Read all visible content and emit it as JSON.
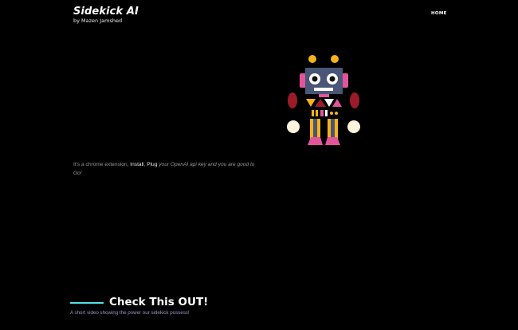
{
  "header": {
    "title": "Sidekick AI",
    "subtitle": "by Mazen Jamshed",
    "nav": {
      "home_label": "HOME"
    }
  },
  "hero": {
    "intro_text": "It's a chrome extension,",
    "step_install": "Install",
    "step_plug": "Plug",
    "intro_rest": "your OpenAI api key and you are good to Go!"
  },
  "cta": {
    "title": "Check This OUT!",
    "subtitle": "A short video showing the power our sidekick possess!"
  },
  "colors": {
    "background": "#000000",
    "accent_line": "#4fe3e8",
    "robot_head": "#4a5677",
    "robot_yellow": "#f7b21a",
    "robot_pink": "#e2559a",
    "robot_red": "#9b1b2b",
    "robot_cream": "#fdf3dc"
  },
  "icons": {
    "robot": "robot-illustration"
  }
}
